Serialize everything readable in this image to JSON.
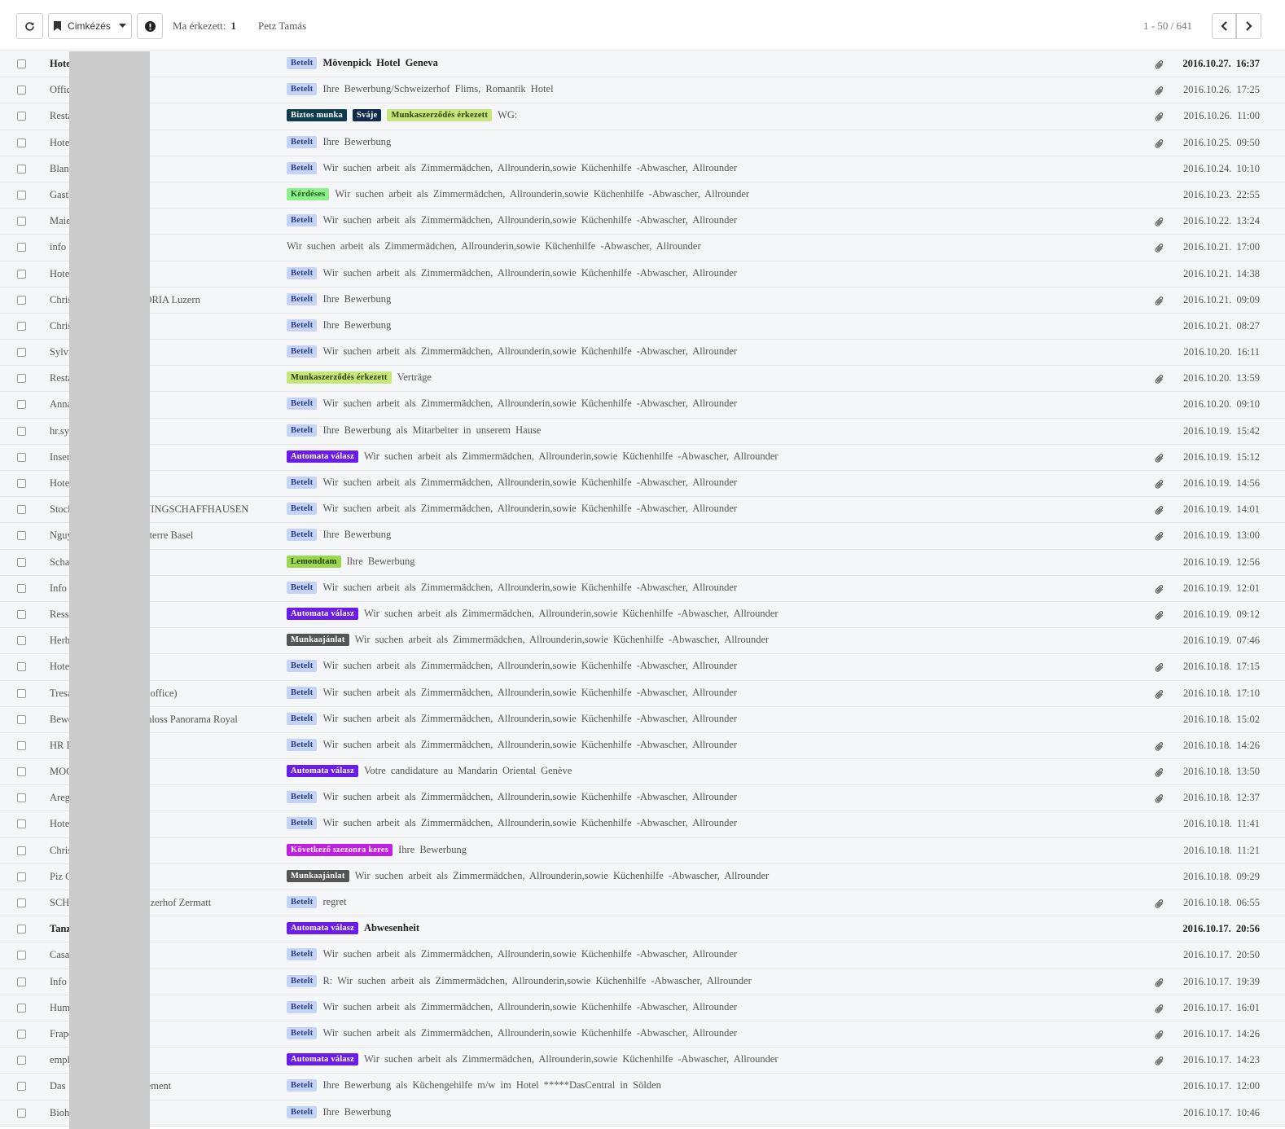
{
  "toolbar": {
    "label_button": "Cimkézés",
    "today_label": "Ma érkezett:",
    "today_count": "1",
    "user_name": "Petz Tamás",
    "pager": "1 - 50 / 641"
  },
  "labels": {
    "Betelt": {
      "bg": "#c5d3f7",
      "fg": "#2a3f80"
    },
    "Biztos munka": {
      "bg": "#0f3c4c",
      "fg": "#ffffff"
    },
    "Sváje": {
      "bg": "#0f2a4a",
      "fg": "#ffffff"
    },
    "Munkaszerződés érkezett": {
      "bg": "#c6e57a",
      "fg": "#2c3f05"
    },
    "Kérdéses": {
      "bg": "#8df08d",
      "fg": "#1a5a1a"
    },
    "Automata válasz": {
      "bg": "#6a1de8",
      "fg": "#ffffff"
    },
    "Lemondtam": {
      "bg": "#9bd84f",
      "fg": "#1f3f06"
    },
    "Munkaajánlat": {
      "bg": "#555555",
      "fg": "#ffffff"
    },
    "Következő szezonra keres": {
      "bg": "#c21ee0",
      "fg": "#ffffff"
    }
  },
  "emails": [
    {
      "sender": "Hote",
      "labels": [
        "Betelt"
      ],
      "subject": "Mövenpick Hotel Geneva",
      "attachment": true,
      "date": "2016.10.27. 16:37",
      "unread": true
    },
    {
      "sender": "Offic",
      "labels": [
        "Betelt"
      ],
      "subject": "Ihre Bewerbung/Schweizerhof Flims, Romantik Hotel",
      "attachment": true,
      "date": "2016.10.26. 17:25",
      "unread": false
    },
    {
      "sender": "Resta                          5)",
      "labels": [
        "Biztos munka",
        "Sváje",
        "Munkaszerződés érkezett"
      ],
      "subject": "WG:",
      "attachment": true,
      "date": "2016.10.26. 11:00",
      "unread": false
    },
    {
      "sender": "Hote",
      "labels": [
        "Betelt"
      ],
      "subject": "Ihre Bewerbung",
      "attachment": true,
      "date": "2016.10.25. 09:50",
      "unread": false
    },
    {
      "sender": "Blanc",
      "labels": [
        "Betelt"
      ],
      "subject": "Wir suchen arbeit als Zimmermädchen, Allrounderin,sowie Küchenhilfe -Abwascher, Allrounder",
      "attachment": false,
      "date": "2016.10.24. 10:10",
      "unread": false
    },
    {
      "sender": "Gasth",
      "labels": [
        "Kérdéses"
      ],
      "subject": "Wir suchen arbeit als Zimmermädchen, Allrounderin,sowie Küchenhilfe -Abwascher, Allrounder",
      "attachment": false,
      "date": "2016.10.23. 22:55",
      "unread": false
    },
    {
      "sender": "Maie",
      "labels": [
        "Betelt"
      ],
      "subject": "Wir suchen arbeit als Zimmermädchen, Allrounderin,sowie Küchenhilfe -Abwascher, Allrounder",
      "attachment": true,
      "date": "2016.10.22. 13:24",
      "unread": false
    },
    {
      "sender": "info",
      "labels": [],
      "subject": "Wir suchen arbeit als Zimmermädchen, Allrounderin,sowie Küchenhilfe -Abwascher, Allrounder",
      "attachment": true,
      "date": "2016.10.21. 17:00",
      "unread": false
    },
    {
      "sender": "Hote",
      "labels": [
        "Betelt"
      ],
      "subject": "Wir suchen arbeit als Zimmermädchen, Allrounderin,sowie Küchenhilfe -Abwascher, Allrounder",
      "attachment": false,
      "date": "2016.10.21. 14:38",
      "unread": false
    },
    {
      "sender": "Chris                        STORIA Luzern",
      "labels": [
        "Betelt"
      ],
      "subject": "Ihre Bewerbung",
      "attachment": true,
      "date": "2016.10.21. 09:09",
      "unread": false
    },
    {
      "sender": "Chris",
      "labels": [
        "Betelt"
      ],
      "subject": "Ihre Bewerbung",
      "attachment": false,
      "date": "2016.10.21. 08:27",
      "unread": false
    },
    {
      "sender": "Sylvi                          s",
      "labels": [
        "Betelt"
      ],
      "subject": "Wir suchen arbeit als Zimmermädchen, Allrounderin,sowie Küchenhilfe -Abwascher, Allrounder",
      "attachment": false,
      "date": "2016.10.20. 16:11",
      "unread": false
    },
    {
      "sender": "Resta                          2)",
      "labels": [
        "Munkaszerződés érkezett"
      ],
      "subject": "Verträge",
      "attachment": true,
      "date": "2016.10.20. 13:59",
      "unread": false
    },
    {
      "sender": "Anna",
      "labels": [
        "Betelt"
      ],
      "subject": "Wir suchen arbeit als Zimmermädchen, Allrounderin,sowie Küchenhilfe -Abwascher, Allrounder",
      "attachment": false,
      "date": "2016.10.20. 09:10",
      "unread": false
    },
    {
      "sender": "hr.sy",
      "labels": [
        "Betelt"
      ],
      "subject": "Ihre Bewerbung als Mitarbeiter in unserem Hause",
      "attachment": false,
      "date": "2016.10.19. 15:42",
      "unread": false
    },
    {
      "sender": "Inser",
      "labels": [
        "Automata válasz"
      ],
      "subject": "Wir suchen arbeit als Zimmermädchen, Allrounderin,sowie Küchenhilfe -Abwascher, Allrounder",
      "attachment": true,
      "date": "2016.10.19. 15:12",
      "unread": false
    },
    {
      "sender": "Hote                           n",
      "labels": [
        "Betelt"
      ],
      "subject": "Wir suchen arbeit als Zimmermädchen, Allrounderin,sowie Küchenhilfe -Abwascher, Allrounder",
      "attachment": true,
      "date": "2016.10.19. 14:56",
      "unread": false
    },
    {
      "sender": "Stock                        LIVINGSCHAFFHAUSEN",
      "labels": [
        "Betelt"
      ],
      "subject": "Wir suchen arbeit als Zimmermädchen, Allrounderin,sowie Küchenhilfe -Abwascher, Allrounder",
      "attachment": true,
      "date": "2016.10.19. 14:01",
      "unread": false
    },
    {
      "sender": "Nguy                         Parterre Basel",
      "labels": [
        "Betelt"
      ],
      "subject": "Ihre Bewerbung",
      "attachment": true,
      "date": "2016.10.19. 13:00",
      "unread": false
    },
    {
      "sender": "Scha",
      "labels": [
        "Lemondtam"
      ],
      "subject": "Ihre Bewerbung",
      "attachment": false,
      "date": "2016.10.19. 12:56",
      "unread": false
    },
    {
      "sender": "Info",
      "labels": [
        "Betelt"
      ],
      "subject": "Wir suchen arbeit als Zimmermädchen, Allrounderin,sowie Küchenhilfe -Abwascher, Allrounder",
      "attachment": true,
      "date": "2016.10.19. 12:01",
      "unread": false
    },
    {
      "sender": "Ress",
      "labels": [
        "Automata válasz"
      ],
      "subject": "Wir suchen arbeit als Zimmermädchen, Allrounderin,sowie Küchenhilfe -Abwascher, Allrounder",
      "attachment": true,
      "date": "2016.10.19. 09:12",
      "unread": false
    },
    {
      "sender": "Herb",
      "labels": [
        "Munkaajánlat"
      ],
      "subject": "Wir suchen arbeit als Zimmermädchen, Allrounderin,sowie Küchenhilfe -Abwascher, Allrounder",
      "attachment": false,
      "date": "2016.10.19. 07:46",
      "unread": false
    },
    {
      "sender": "Hote",
      "labels": [
        "Betelt"
      ],
      "subject": "Wir suchen arbeit als Zimmermädchen, Allrounderin,sowie Küchenhilfe -Abwascher, Allrounder",
      "attachment": true,
      "date": "2016.10.18. 17:15",
      "unread": false
    },
    {
      "sender": "Tresa                          ve office)",
      "labels": [
        "Betelt"
      ],
      "subject": "Wir suchen arbeit als Zimmermädchen, Allrounderin,sowie Küchenhilfe -Abwascher, Allrounder",
      "attachment": true,
      "date": "2016.10.18. 17:10",
      "unread": false
    },
    {
      "sender": "Bewe                         Schloss Panorama Royal",
      "labels": [
        "Betelt"
      ],
      "subject": "Wir suchen arbeit als Zimmermädchen, Allrounderin,sowie Küchenhilfe -Abwascher, Allrounder",
      "attachment": false,
      "date": "2016.10.18. 15:02",
      "unread": false
    },
    {
      "sender": "HR I",
      "labels": [
        "Betelt"
      ],
      "subject": "Wir suchen arbeit als Zimmermädchen, Allrounderin,sowie Küchenhilfe -Abwascher, Allrounder",
      "attachment": true,
      "date": "2016.10.18. 14:26",
      "unread": false
    },
    {
      "sender": "MOC",
      "labels": [
        "Automata válasz"
      ],
      "subject": "Votre candidature au Mandarin Oriental Genève",
      "attachment": true,
      "date": "2016.10.18. 13:50",
      "unread": false
    },
    {
      "sender": "Areg",
      "labels": [
        "Betelt"
      ],
      "subject": "Wir suchen arbeit als Zimmermädchen, Allrounderin,sowie Küchenhilfe -Abwascher, Allrounder",
      "attachment": true,
      "date": "2016.10.18. 12:37",
      "unread": false
    },
    {
      "sender": "Hote",
      "labels": [
        "Betelt"
      ],
      "subject": "Wir suchen arbeit als Zimmermädchen, Allrounderin,sowie Küchenhilfe -Abwascher, Allrounder",
      "attachment": false,
      "date": "2016.10.18. 11:41",
      "unread": false
    },
    {
      "sender": "Chris",
      "labels": [
        "Következő szezonra keres"
      ],
      "subject": "Ihre Bewerbung",
      "attachment": false,
      "date": "2016.10.18. 11:21",
      "unread": false
    },
    {
      "sender": "Piz C",
      "labels": [
        "Munkaajánlat"
      ],
      "subject": "Wir suchen arbeit als Zimmermädchen, Allrounderin,sowie Küchenhilfe -Abwascher, Allrounder",
      "attachment": false,
      "date": "2016.10.18. 09:29",
      "unread": false
    },
    {
      "sender": "SCH                          weizerhof Zermatt",
      "labels": [
        "Betelt"
      ],
      "subject": "regret",
      "attachment": true,
      "date": "2016.10.18. 06:55",
      "unread": false
    },
    {
      "sender": "Tanz",
      "labels": [
        "Automata válasz"
      ],
      "subject": "Abwesenheit",
      "attachment": false,
      "date": "2016.10.17. 20:56",
      "unread": true
    },
    {
      "sender": "Casa",
      "labels": [
        "Betelt"
      ],
      "subject": "Wir suchen arbeit als Zimmermädchen, Allrounderin,sowie Küchenhilfe -Abwascher, Allrounder",
      "attachment": false,
      "date": "2016.10.17. 20:50",
      "unread": false
    },
    {
      "sender": "Info",
      "labels": [
        "Betelt"
      ],
      "subject": "R: Wir suchen arbeit als Zimmermädchen, Allrounderin,sowie Küchenhilfe -Abwascher, Allrounder",
      "attachment": true,
      "date": "2016.10.17. 19:39",
      "unread": false
    },
    {
      "sender": "Hum",
      "labels": [
        "Betelt"
      ],
      "subject": "Wir suchen arbeit als Zimmermädchen, Allrounderin,sowie Küchenhilfe -Abwascher, Allrounder",
      "attachment": true,
      "date": "2016.10.17. 16:01",
      "unread": false
    },
    {
      "sender": "Frapo",
      "labels": [
        "Betelt"
      ],
      "subject": "Wir suchen arbeit als Zimmermädchen, Allrounderin,sowie Küchenhilfe -Abwascher, Allrounder",
      "attachment": true,
      "date": "2016.10.17. 14:26",
      "unread": false
    },
    {
      "sender": "empl",
      "labels": [
        "Automata válasz"
      ],
      "subject": "Wir suchen arbeit als Zimmermädchen, Allrounderin,sowie Küchenhilfe -Abwascher, Allrounder",
      "attachment": true,
      "date": "2016.10.17. 14:23",
      "unread": false
    },
    {
      "sender": "Das                          nagement",
      "labels": [
        "Betelt"
      ],
      "subject": "Ihre Bewerbung als Küchengehilfe m/w im Hotel *****DasCentral in Sölden",
      "attachment": false,
      "date": "2016.10.17. 12:00",
      "unread": false
    },
    {
      "sender": "Bioh",
      "labels": [
        "Betelt"
      ],
      "subject": "Ihre Bewerbung",
      "attachment": false,
      "date": "2016.10.17. 10:46",
      "unread": false
    }
  ]
}
